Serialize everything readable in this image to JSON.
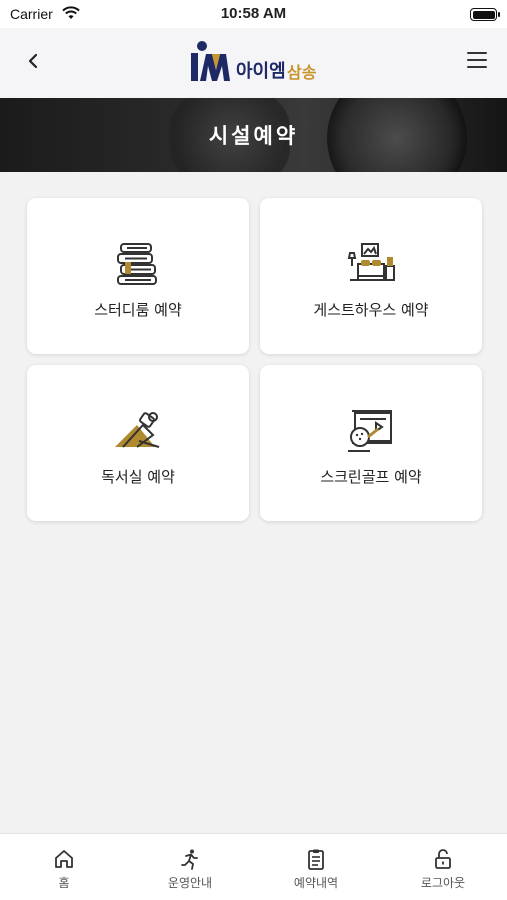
{
  "status": {
    "carrier": "Carrier",
    "time": "10:58 AM"
  },
  "header": {
    "logo_text": "아이엠",
    "logo_suffix": "삼송",
    "title": "시설예약"
  },
  "facilities": [
    {
      "label": "스터디룸 예약",
      "icon": "books-icon"
    },
    {
      "label": "게스트하우스 예약",
      "icon": "bedroom-icon"
    },
    {
      "label": "독서실 예약",
      "icon": "desk-lamp-icon"
    },
    {
      "label": "스크린골프 예약",
      "icon": "golf-screen-icon"
    }
  ],
  "tabbar": [
    {
      "label": "홈",
      "icon": "home-icon"
    },
    {
      "label": "운영안내",
      "icon": "runner-icon"
    },
    {
      "label": "예약내역",
      "icon": "clipboard-icon"
    },
    {
      "label": "로그아웃",
      "icon": "unlock-icon"
    }
  ],
  "colors": {
    "brand_navy": "#1e2a66",
    "brand_gold": "#c9962d",
    "icon_gold": "#b08a2e"
  }
}
